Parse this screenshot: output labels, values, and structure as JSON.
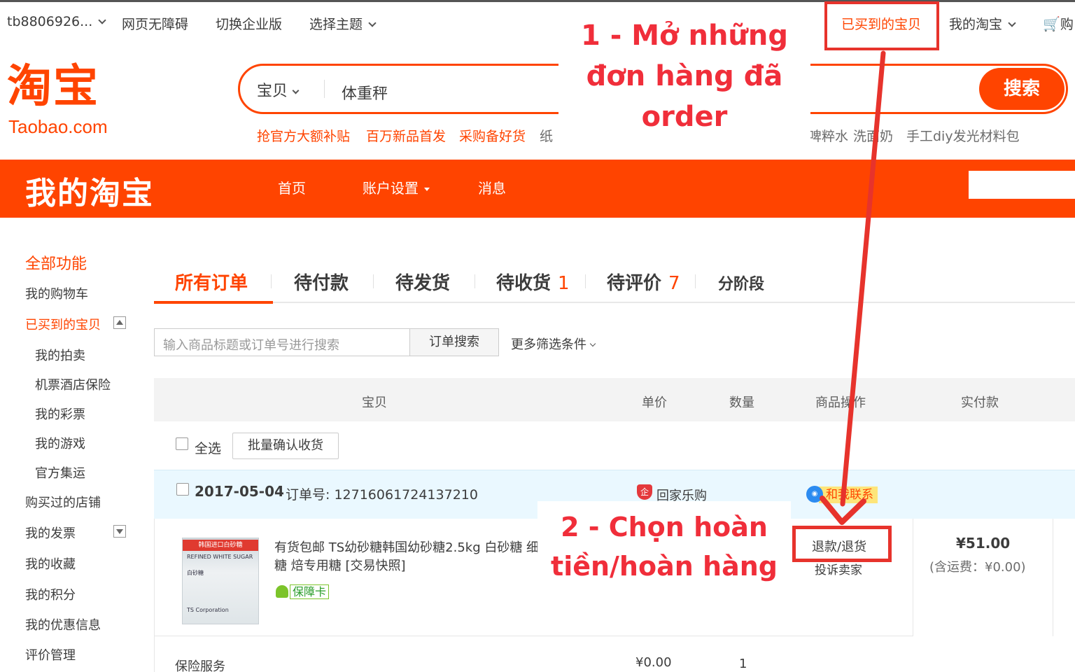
{
  "site_nav": {
    "username": "tb8806926...",
    "accessibility": "网页无障碍",
    "enterprise": "切换企业版",
    "theme": "选择主题",
    "bought": "已买到的宝贝",
    "my_taobao": "我的淘宝",
    "cart": "购"
  },
  "header": {
    "logo": "淘宝",
    "logo_sub": "Taobao.com",
    "search_type": "宝贝",
    "search_value": "体重秤",
    "search_button": "搜索",
    "hot_words": [
      {
        "text": "抢官方大额补贴",
        "style": "red"
      },
      {
        "text": "百万新品首发",
        "style": "red"
      },
      {
        "text": "采购备好货",
        "style": "red"
      },
      {
        "text": "纸",
        "style": "gray"
      },
      {
        "text": "啤粹水",
        "style": "gray"
      },
      {
        "text": "洗面奶",
        "style": "gray"
      },
      {
        "text": "手工diy发光材料包",
        "style": "gray"
      }
    ]
  },
  "mytaobao_bar": {
    "title": "我的淘宝",
    "links": [
      "首页",
      "账户设置",
      "消息"
    ]
  },
  "sidebar": {
    "all_functions": "全部功能",
    "items": [
      "我的购物车",
      "已买到的宝贝",
      "我的拍卖",
      "机票酒店保险",
      "我的彩票",
      "我的游戏",
      "官方集运",
      "购买过的店铺",
      "我的发票",
      "我的收藏",
      "我的积分",
      "我的优惠信息",
      "评价管理"
    ]
  },
  "tabs": [
    {
      "label": "所有订单",
      "count": ""
    },
    {
      "label": "待付款",
      "count": ""
    },
    {
      "label": "待发货",
      "count": ""
    },
    {
      "label": "待收货",
      "count": "1"
    },
    {
      "label": "待评价",
      "count": "7"
    },
    {
      "label": "分阶段",
      "count": ""
    }
  ],
  "order_search": {
    "placeholder": "输入商品标题或订单号进行搜索",
    "button": "订单搜索",
    "more_filters": "更多筛选条件"
  },
  "table_headers": [
    "宝贝",
    "单价",
    "数量",
    "商品操作",
    "实付款"
  ],
  "bulk": {
    "select_all": "全选",
    "batch_confirm": "批量确认收货"
  },
  "order": {
    "date": "2017-05-04",
    "order_no_label": "订单号:",
    "order_no": "12716061724137210",
    "shop_badge": "企",
    "shop_name": "回家乐购",
    "contact": "和我联系",
    "item": {
      "title": "有货包邮 TS幼砂糖韩国幼砂糖2.5kg 白砂糖 细砂糖 焙专用糖 [交易快照]",
      "guarantee": "保障卡",
      "thumb_band": "韩国进口白砂糖",
      "thumb_line1": "REFINED WHITE SUGAR",
      "thumb_line2": "白砂糖",
      "thumb_line3": "TS Corporation"
    },
    "actions": {
      "refund": "退款/退货",
      "complain": "投诉卖家"
    },
    "total": "¥51.00",
    "shipping": "(含运费：¥0.00)",
    "insurance": {
      "name": "保险服务",
      "price": "¥0.00",
      "qty": "1"
    }
  },
  "annotations": {
    "step1": "1 - Mở những đơn hàng đã order",
    "step2": "2 - Chọn hoàn tiền/hoàn hàng",
    "color": "#f02e3a"
  },
  "colors": {
    "brand": "#ff4400",
    "annotation": "#e7332c"
  }
}
